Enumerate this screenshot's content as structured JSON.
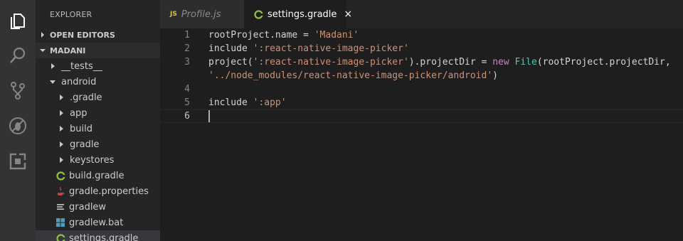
{
  "activity_bar": {
    "items": [
      {
        "name": "explorer",
        "icon": "files-icon"
      },
      {
        "name": "search",
        "icon": "search-icon"
      },
      {
        "name": "source-control",
        "icon": "source-control-icon"
      },
      {
        "name": "debug",
        "icon": "debug-icon"
      },
      {
        "name": "extensions",
        "icon": "extensions-icon"
      }
    ]
  },
  "sidebar": {
    "title": "EXPLORER",
    "open_editors_label": "OPEN EDITORS",
    "project_label": "MADANI",
    "tree": [
      {
        "label": "__tests__",
        "type": "folder",
        "expanded": false
      },
      {
        "label": "android",
        "type": "folder",
        "expanded": true
      },
      {
        "label": ".gradle",
        "type": "folder",
        "expanded": false
      },
      {
        "label": "app",
        "type": "folder",
        "expanded": false
      },
      {
        "label": "build",
        "type": "folder",
        "expanded": false
      },
      {
        "label": "gradle",
        "type": "folder",
        "expanded": false
      },
      {
        "label": "keystores",
        "type": "folder",
        "expanded": false
      },
      {
        "label": "build.gradle",
        "type": "file",
        "icon": "gradle-icon"
      },
      {
        "label": "gradle.properties",
        "type": "file",
        "icon": "java-icon"
      },
      {
        "label": "gradlew",
        "type": "file",
        "icon": "text-lines-icon"
      },
      {
        "label": "gradlew.bat",
        "type": "file",
        "icon": "windows-icon"
      },
      {
        "label": "settings.gradle",
        "type": "file",
        "icon": "gradle-icon",
        "selected": true
      }
    ]
  },
  "tabs": [
    {
      "label": "Profile.js",
      "badge": "JS",
      "active": false
    },
    {
      "label": "settings.gradle",
      "active": true,
      "close": "×"
    }
  ],
  "editor": {
    "lines": [
      {
        "n": "1",
        "tokens": [
          [
            "rootProject.name = ",
            "p"
          ],
          [
            "'Madani'",
            "s"
          ]
        ]
      },
      {
        "n": "2",
        "tokens": [
          [
            "include ",
            "p"
          ],
          [
            "':react-native-image-picker'",
            "s"
          ]
        ]
      },
      {
        "n": "3",
        "tokens": [
          [
            "project(",
            "p"
          ],
          [
            "':react-native-image-picker'",
            "s"
          ],
          [
            ").projectDir = ",
            "p"
          ],
          [
            "new",
            "k"
          ],
          [
            " ",
            "p"
          ],
          [
            "File",
            "c"
          ],
          [
            "(rootProject.projectDir,",
            "p"
          ]
        ]
      },
      {
        "n": "",
        "tokens": [
          [
            "'../node_modules/react-native-image-picker/android'",
            "s"
          ],
          [
            ")",
            "p"
          ]
        ]
      },
      {
        "n": "4",
        "tokens": []
      },
      {
        "n": "5",
        "tokens": [
          [
            "include ",
            "p"
          ],
          [
            "':app'",
            "s"
          ]
        ]
      },
      {
        "n": "6",
        "tokens": [],
        "current": true
      }
    ]
  },
  "colors": {
    "string": "#ce9178",
    "keyword": "#c586c0",
    "class": "#4ec9b0",
    "gradle": "#8dc149",
    "java": "#cc3e44",
    "windows": "#519aba"
  }
}
